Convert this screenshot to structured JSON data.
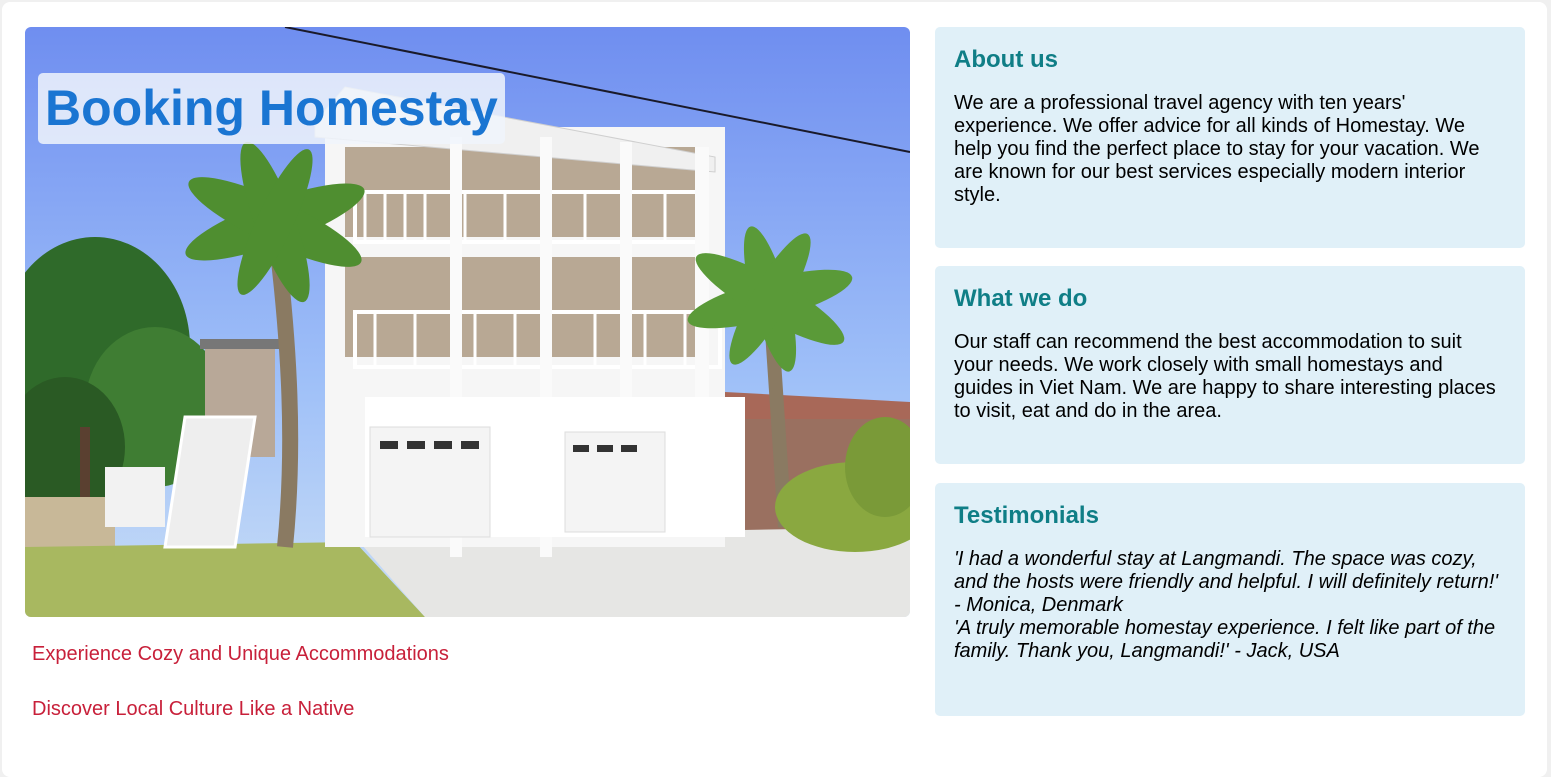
{
  "colors": {
    "heading": "#0f7e86",
    "title": "#1a75d2",
    "link": "#c8203a",
    "card_bg": "#e0f0f8"
  },
  "hero": {
    "title": "Booking Homestay"
  },
  "links": [
    {
      "label": "Experience Cozy and Unique Accommodations"
    },
    {
      "label": "Discover Local Culture Like a Native"
    }
  ],
  "about": {
    "heading": "About us",
    "text": "We are a professional travel agency with ten years' experience. We offer advice for all kinds of Homestay. We help you find the perfect place to stay for your vacation. We are known for our best services especially modern interior style."
  },
  "what_we_do": {
    "heading": "What we do",
    "text": "Our staff can recommend the best accommodation to suit your needs. We work closely with small homestays and guides in Viet Nam. We are happy to share interesting places to visit, eat and do in the area."
  },
  "testimonials": {
    "heading": "Testimonials",
    "quotes": [
      "'I had a wonderful stay at Langmandi. The space was cozy, and the hosts were friendly and helpful. I will definitely return!' - Monica, Denmark",
      "'A truly memorable homestay experience. I felt like part of the family. Thank you, Langmandi!' - Jack, USA"
    ]
  }
}
